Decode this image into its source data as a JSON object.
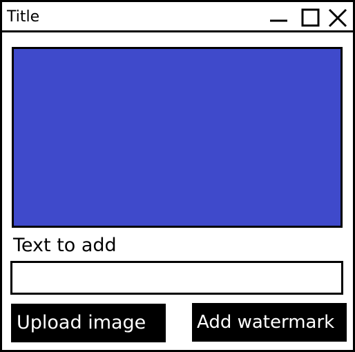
{
  "window": {
    "title": "Title"
  },
  "titlebar_controls": {
    "minimize_icon": "minimize-icon",
    "maximize_icon": "maximize-icon",
    "close_icon": "close-icon"
  },
  "preview": {
    "fill_color": "#3f4acb"
  },
  "form": {
    "label": "Text to add",
    "input_value": "",
    "input_placeholder": ""
  },
  "buttons": {
    "upload_label": "Upload image",
    "watermark_label": "Add watermark"
  }
}
